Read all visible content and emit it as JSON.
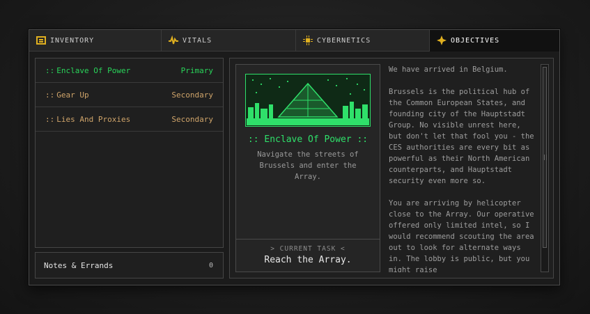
{
  "tabs": [
    {
      "label": "INVENTORY",
      "icon": "inventory-icon",
      "active": false
    },
    {
      "label": "VITALS",
      "icon": "vitals-icon",
      "active": false
    },
    {
      "label": "CYBERNETICS",
      "icon": "cybernetics-icon",
      "active": false
    },
    {
      "label": "OBJECTIVES",
      "icon": "objectives-icon",
      "active": true
    }
  ],
  "objectives": [
    {
      "prefix": "::",
      "name": "Enclave Of Power",
      "type": "Primary",
      "active": true
    },
    {
      "prefix": "::",
      "name": "Gear Up",
      "type": "Secondary",
      "active": false
    },
    {
      "prefix": "::",
      "name": "Lies And Proxies",
      "type": "Secondary",
      "active": false
    }
  ],
  "notes": {
    "label": "Notes & Errands",
    "count": "0"
  },
  "detail": {
    "title": ":: Enclave Of Power ::",
    "description": "Navigate the streets of Brussels and enter the Array.",
    "task_label": "> CURRENT TASK <",
    "task_value": "Reach the Array.",
    "paragraphs": [
      "We have arrived in Belgium.",
      "Brussels is the political hub of the Common European States, and founding city of the Hauptstadt Group. No visible unrest here, but don't let that fool you - the CES authorities are every bit as powerful as their North American counterparts, and Hauptstadt security even more so.",
      "You are arriving by helicopter close to the Array. Our operative offered only limited intel, so I would recommend scouting the area out to look for alternate ways in. The lobby is public, but you might raise"
    ]
  },
  "colors": {
    "accent_green": "#2fe06a",
    "objective_orange": "#cfa46a",
    "icon_gold": "#e0b020"
  }
}
